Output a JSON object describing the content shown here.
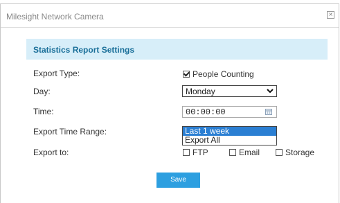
{
  "window": {
    "title": "Milesight Network Camera"
  },
  "section": {
    "title": "Statistics Report Settings"
  },
  "form": {
    "export_type": {
      "label": "Export Type:",
      "option": "People Counting",
      "checked": true
    },
    "day": {
      "label": "Day:",
      "value": "Monday"
    },
    "time": {
      "label": "Time:",
      "value": "00:00:00"
    },
    "export_time_range": {
      "label": "Export Time Range:",
      "options": [
        "Last 1 week",
        "Export All"
      ],
      "selected": "Last 1 week"
    },
    "export_to": {
      "label": "Export to:",
      "options": [
        {
          "label": "FTP",
          "checked": false
        },
        {
          "label": "Email",
          "checked": false
        },
        {
          "label": "Storage",
          "checked": false
        }
      ]
    }
  },
  "actions": {
    "save_label": "Save"
  },
  "colors": {
    "accent": "#2d9fe0",
    "header_bg": "#d7eef9",
    "header_text": "#1a6f99",
    "selection": "#2b7fd3"
  }
}
